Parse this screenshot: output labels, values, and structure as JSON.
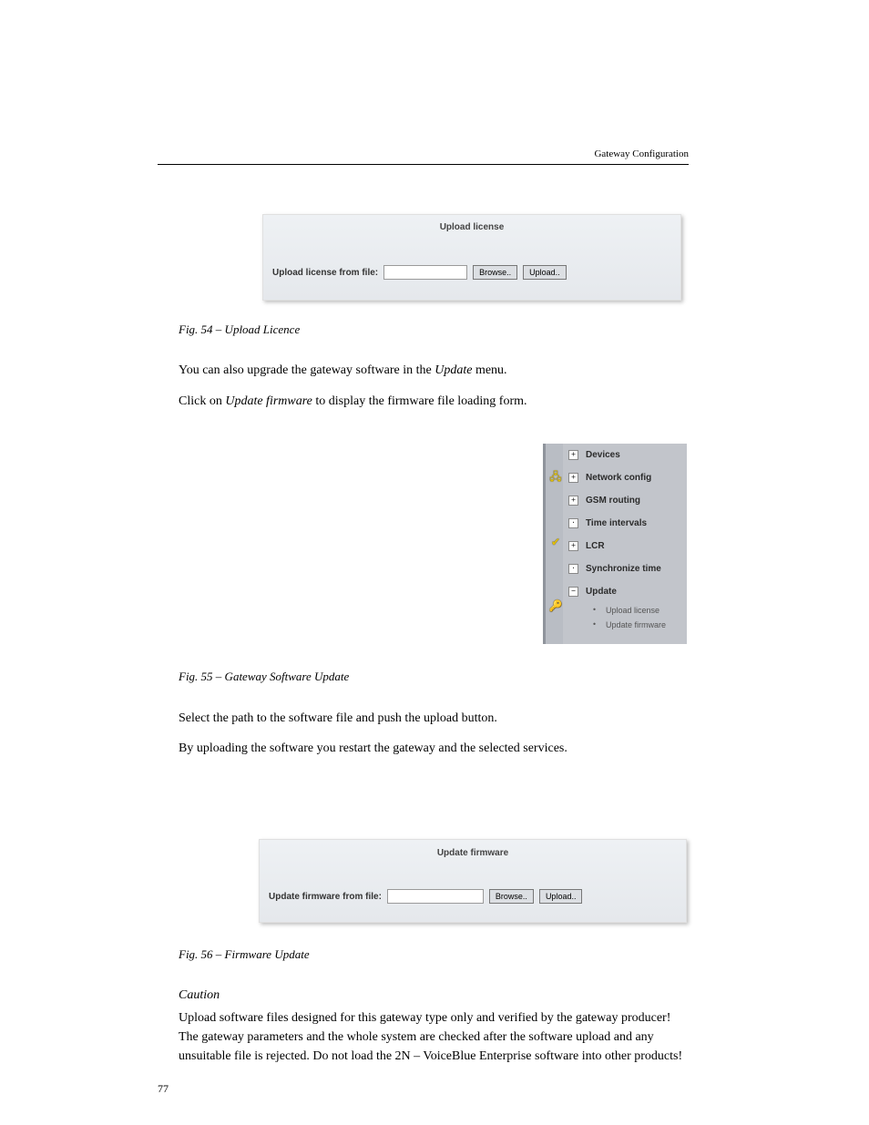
{
  "running_head": "Gateway Configuration",
  "panel_license": {
    "title": "Upload license",
    "label": "Upload license from file:",
    "browse": "Browse..",
    "upload": "Upload.."
  },
  "fig1": "Fig. 54 – Upload Licence",
  "para_above_fig2": {
    "p1_a": "You can also upgrade the gateway software in the ",
    "p1_b": "Update ",
    "p1_c": "menu.",
    "p2_a": "Click on ",
    "p2_b": "Update firmware ",
    "p2_c": "to display the firmware file loading form."
  },
  "nav": {
    "items": [
      {
        "label": "Devices",
        "expander": "+"
      },
      {
        "label": "Network config",
        "expander": "+"
      },
      {
        "label": "GSM routing",
        "expander": "+"
      },
      {
        "label": "Time intervals",
        "expander": "·"
      },
      {
        "label": "LCR",
        "expander": "+"
      },
      {
        "label": "Synchronize time",
        "expander": "·"
      },
      {
        "label": "Update",
        "expander": "−"
      }
    ],
    "subitems": [
      {
        "label": "Upload license"
      },
      {
        "label": "Update firmware"
      }
    ]
  },
  "fig2": "Fig. 55 – Gateway Software Update",
  "para_below_fig2": {
    "p1": "Select the path to the software file and push the upload button.",
    "p2": "By uploading the software you restart the gateway and the selected services."
  },
  "panel_firmware": {
    "title": "Update firmware",
    "label": "Update firmware from file:",
    "browse": "Browse..",
    "update": "Upload.."
  },
  "fig3": "Fig. 56 – Firmware Update",
  "caution_heading": "Caution",
  "caution_body": "Upload software files designed for this gateway type only and verified by the gateway producer! The gateway parameters and the whole system are checked after the software upload and any unsuitable file is rejected. Do not load the 2N – VoiceBlue Enterprise software into other products!",
  "page_number": "77"
}
